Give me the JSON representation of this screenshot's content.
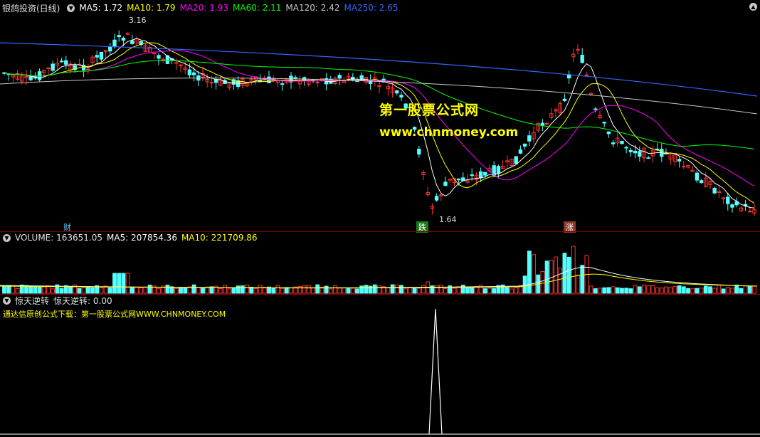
{
  "main": {
    "title": "银鸽投资(日线)",
    "ma_items": [
      {
        "label": "MA5: 1.72",
        "color": "#ffffff"
      },
      {
        "label": "MA10: 1.79",
        "color": "#ffff00"
      },
      {
        "label": "MA20: 1.93",
        "color": "#ff00ff"
      },
      {
        "label": "MA60: 2.11",
        "color": "#00ff00"
      },
      {
        "label": "MA120: 2.42",
        "color": "#c8c8c8"
      },
      {
        "label": "MA250: 2.65",
        "color": "#3366ff"
      }
    ],
    "high_label": "3.16",
    "low_label": "1.64",
    "watermark_cn": "第一股票公式网",
    "watermark_url": "www.chnmoney.com",
    "markers": [
      {
        "text": "财",
        "color": "#66ccff",
        "bg": "#1a3d66"
      },
      {
        "text": "跌",
        "color": "#ffffff",
        "bg": "#1a7a1a"
      },
      {
        "text": "涨",
        "color": "#ffffff",
        "bg": "#8b3a2a"
      }
    ]
  },
  "volume": {
    "title": "VOLUME: 163651.05",
    "ma5": "MA5: 207854.36",
    "ma10": "MA10: 221709.86"
  },
  "indicator": {
    "name": "惊天逆转",
    "value": "惊天逆转: 0.00",
    "note": "通达信原创公式下载：第一股票公式网WWW.CHNMONEY.COM"
  },
  "colors": {
    "up": "#ff3232",
    "down": "#54ffff",
    "bg": "#000000"
  }
}
